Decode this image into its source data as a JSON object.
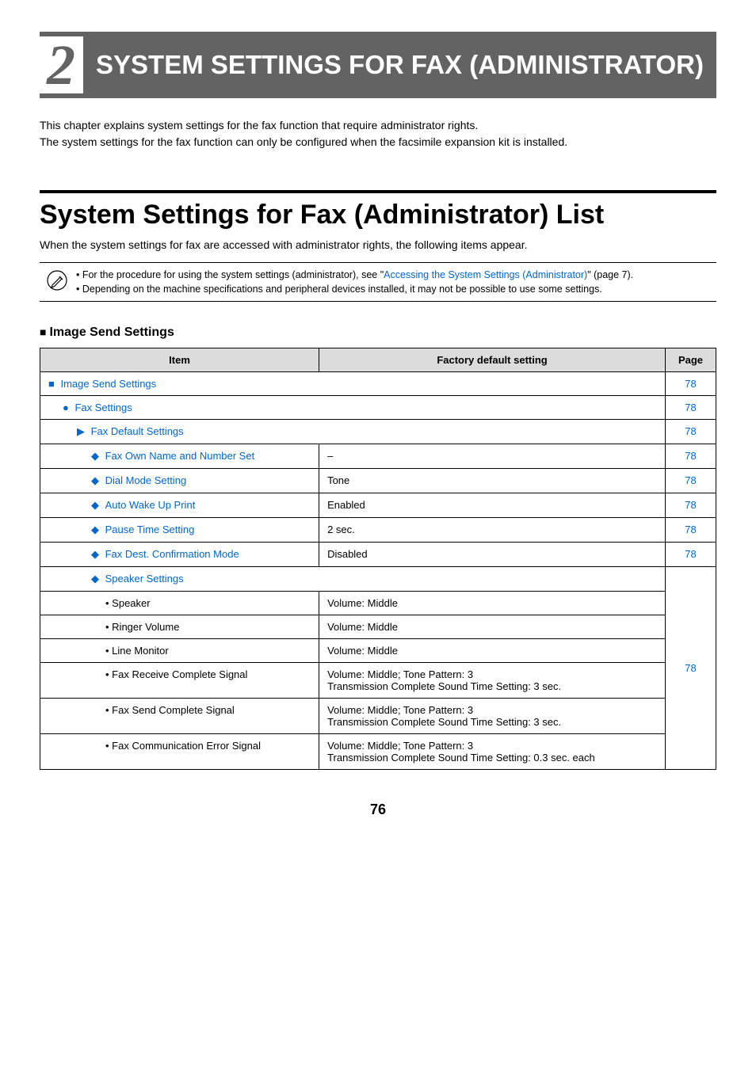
{
  "chapter": {
    "number": "2",
    "title": "SYSTEM SETTINGS FOR FAX (ADMINISTRATOR)"
  },
  "intro": {
    "line1": "This chapter explains system settings for the fax function that require administrator rights.",
    "line2": "The system settings for the fax function can only be configured when the facsimile expansion kit is installed."
  },
  "section": {
    "title": "System Settings for Fax (Administrator) List",
    "sub": "When the system settings for fax are accessed with administrator rights, the following items appear."
  },
  "note": {
    "bullet1_prefix": "• For the procedure for using the system settings (administrator), see \"",
    "bullet1_link": "Accessing the System Settings (Administrator)",
    "bullet1_suffix": "\" (page 7).",
    "bullet2": "• Depending on the machine specifications and peripheral devices installed, it may not be possible to use some settings."
  },
  "subhead": "Image Send Settings",
  "table": {
    "headers": {
      "item": "Item",
      "factory": "Factory default setting",
      "page": "Page"
    },
    "rows": [
      {
        "item": "Image Send Settings",
        "factory": "",
        "page": "78",
        "span": true,
        "link": true,
        "indent": 1,
        "marker": "■"
      },
      {
        "item": "Fax Settings",
        "factory": "",
        "page": "78",
        "span": true,
        "link": true,
        "indent": 2,
        "marker": "●"
      },
      {
        "item": "Fax Default Settings",
        "factory": "",
        "page": "78",
        "span": true,
        "link": true,
        "indent": 3,
        "marker": "▶"
      },
      {
        "item": "Fax Own Name and Number Set",
        "factory": "–",
        "page": "78",
        "link": true,
        "indent": 4,
        "marker": "◆"
      },
      {
        "item": "Dial Mode Setting",
        "factory": "Tone",
        "page": "78",
        "link": true,
        "indent": 4,
        "marker": "◆"
      },
      {
        "item": "Auto Wake Up Print",
        "factory": "Enabled",
        "page": "78",
        "link": true,
        "indent": 4,
        "marker": "◆"
      },
      {
        "item": "Pause Time Setting",
        "factory": "2 sec.",
        "page": "78",
        "link": true,
        "indent": 4,
        "marker": "◆"
      },
      {
        "item": "Fax Dest. Confirmation Mode",
        "factory": "Disabled",
        "page": "78",
        "link": true,
        "indent": 4,
        "marker": "◆"
      },
      {
        "item": "Speaker Settings",
        "factory": "",
        "page": "78",
        "span": true,
        "link": true,
        "indent": 4,
        "marker": "◆",
        "group_start": true
      },
      {
        "item": "• Speaker",
        "factory": "Volume: Middle",
        "page": "",
        "link": false,
        "indent": 5
      },
      {
        "item": "• Ringer Volume",
        "factory": "Volume: Middle",
        "page": "",
        "link": false,
        "indent": 5
      },
      {
        "item": "• Line Monitor",
        "factory": "Volume: Middle",
        "page": "",
        "link": false,
        "indent": 5
      },
      {
        "item": "• Fax Receive Complete Signal",
        "factory": "Volume: Middle; Tone Pattern: 3\nTransmission Complete Sound Time Setting: 3 sec.",
        "page": "",
        "link": false,
        "indent": 5
      },
      {
        "item": "• Fax Send Complete Signal",
        "factory": "Volume: Middle; Tone Pattern: 3\nTransmission Complete Sound Time Setting: 3 sec.",
        "page": "",
        "link": false,
        "indent": 5
      },
      {
        "item": "• Fax Communication Error Signal",
        "factory": "Volume: Middle; Tone Pattern: 3\nTransmission Complete Sound Time Setting: 0.3 sec. each",
        "page": "",
        "link": false,
        "indent": 5
      }
    ],
    "group_page": "78"
  },
  "page_number": "76"
}
